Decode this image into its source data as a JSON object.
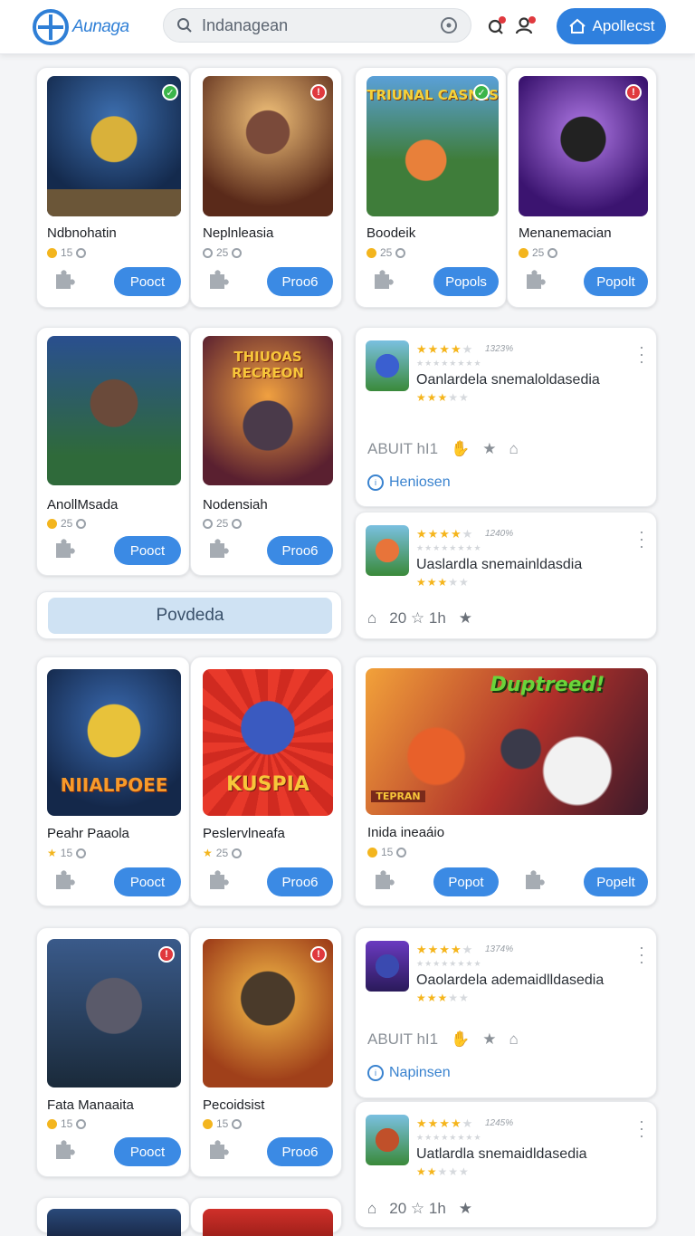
{
  "header": {
    "logo_text": "Aunaga",
    "search_value": "Indanagean",
    "apply_label": "Apollecst"
  },
  "colors": {
    "accent": "#2f80de",
    "star": "#f5b51c",
    "badge_green": "#3bb54a",
    "badge_red": "#e0393e"
  },
  "tiles": [
    {
      "title": "Ndbnohatin",
      "count": "15",
      "button": "Pooct"
    },
    {
      "title": "Neplnleasia",
      "count": "25",
      "button": "Proo6"
    },
    {
      "title": "Boodeik",
      "count": "25",
      "button": "Popols"
    },
    {
      "title": "Menanemacian",
      "count": "25",
      "button": "Popolt"
    },
    {
      "title": "AnollMsada",
      "count": "25",
      "button": "Pooct"
    },
    {
      "title": "Nodensiah",
      "count": "25",
      "button": "Proo6"
    },
    {
      "title": "Peahr Paaola",
      "count": "15",
      "button": "Pooct"
    },
    {
      "title": "Peslervlneafa",
      "count": "25",
      "button": "Proo6"
    },
    {
      "title": "Fata Manaaita",
      "count": "15",
      "button": "Pooct"
    },
    {
      "title": "Pecoidsist",
      "count": "15",
      "button": "Proo6"
    }
  ],
  "art_labels": {
    "boodeik": "TRIUNAL CASNES",
    "nodensiah": "THIUOAS RECREON",
    "peahr": "NIIALPOEE",
    "peslerv": "KUSPIA",
    "indda": "Duptreed!",
    "indda_banner": "TEPRAN"
  },
  "promo": {
    "label": "Povdeda"
  },
  "wide_card": {
    "title": "Inida ineaáio",
    "count": "15",
    "button_1": "Popot",
    "button_2": "Popelt"
  },
  "reviews": [
    {
      "count": "1323%",
      "text": "Oanlardela snemaloldasedia",
      "actions": "ABUIT hI1",
      "tag": "Heniosen"
    },
    {
      "count": "1240%",
      "text": "Uaslardla snemainldasdia",
      "actions": "20 ☆ 1h"
    },
    {
      "count": "1374%",
      "text": "Oaolardela ademaidlldasedia",
      "actions": "ABUIT hI1",
      "tag": "Napinsen"
    },
    {
      "count": "1245%",
      "text": "Uatlardla snemaidldasedia",
      "actions": "20 ☆ 1h"
    }
  ]
}
